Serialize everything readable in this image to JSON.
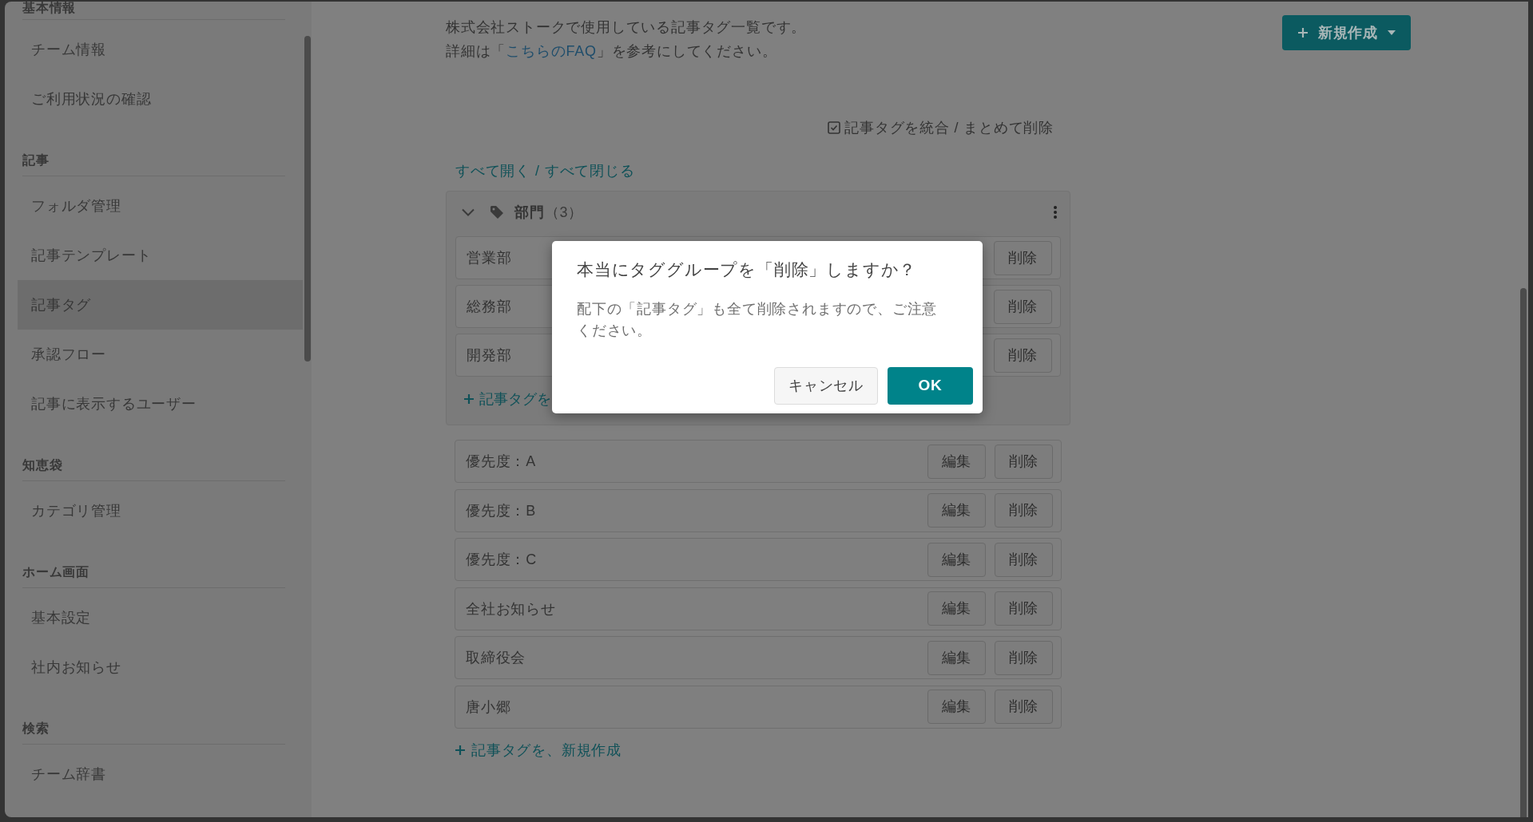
{
  "sidebar": {
    "sections": [
      {
        "heading": "基本情報",
        "items": [
          {
            "label": "チーム情報",
            "selected": false
          },
          {
            "label": "ご利用状況の確認",
            "selected": false
          }
        ]
      },
      {
        "heading": "記事",
        "items": [
          {
            "label": "フォルダ管理",
            "selected": false
          },
          {
            "label": "記事テンプレート",
            "selected": false
          },
          {
            "label": "記事タグ",
            "selected": true
          },
          {
            "label": "承認フロー",
            "selected": false
          },
          {
            "label": "記事に表示するユーザー",
            "selected": false
          }
        ]
      },
      {
        "heading": "知恵袋",
        "items": [
          {
            "label": "カテゴリ管理",
            "selected": false
          }
        ]
      },
      {
        "heading": "ホーム画面",
        "items": [
          {
            "label": "基本設定",
            "selected": false
          },
          {
            "label": "社内お知らせ",
            "selected": false
          }
        ]
      },
      {
        "heading": "検索",
        "items": [
          {
            "label": "チーム辞書",
            "selected": false
          }
        ]
      }
    ]
  },
  "description": {
    "text": "株式会社ストークで使用している記事タグ一覧です。",
    "detail": {
      "before": "詳細は「",
      "link": "こちらのFAQ",
      "after": "」を参考にしてください。"
    }
  },
  "new_button": {
    "label": "新規作成"
  },
  "bulk_action": {
    "label": "記事タグを統合 / まとめて削除"
  },
  "expand_controls": {
    "expand_all": "すべて開く",
    "separator": "/",
    "collapse_all": "すべて閉じる"
  },
  "tag_groups": [
    {
      "name": "部門",
      "count": "（3）",
      "expanded": true,
      "tags": [
        {
          "name": "営業部",
          "delete": "削除"
        },
        {
          "name": "総務部",
          "delete": "削除"
        },
        {
          "name": "開発部",
          "delete": "削除"
        }
      ],
      "add_link": "記事タグを"
    }
  ],
  "tags": [
    {
      "name": "優先度：A",
      "edit": "編集",
      "delete": "削除"
    },
    {
      "name": "優先度：B",
      "edit": "編集",
      "delete": "削除"
    },
    {
      "name": "優先度：C",
      "edit": "編集",
      "delete": "削除"
    },
    {
      "name": "全社お知らせ",
      "edit": "編集",
      "delete": "削除"
    },
    {
      "name": "取締役会",
      "edit": "編集",
      "delete": "削除"
    },
    {
      "name": "唐小郷",
      "edit": "編集",
      "delete": "削除"
    }
  ],
  "add_link": "記事タグを、新規作成",
  "dialog": {
    "title": "本当にタググループを「削除」しますか？",
    "message": "配下の「記事タグ」も全て削除されますので、ご注意ください。",
    "cancel": "キャンセル",
    "ok": "OK"
  }
}
